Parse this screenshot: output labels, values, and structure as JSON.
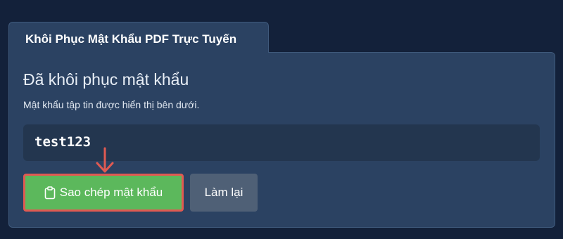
{
  "tab": {
    "label": "Khôi Phục Mật Khẩu PDF Trực Tuyến"
  },
  "result": {
    "title": "Đã khôi phục mật khẩu",
    "subtitle": "Mật khẩu tập tin được hiển thị bên dưới.",
    "password": "test123"
  },
  "buttons": {
    "copy_label": "Sao chép mật khẩu",
    "copy_icon": "clipboard-icon",
    "reset_label": "Làm lại"
  },
  "annotation": {
    "arrow_icon": "arrow-down-icon",
    "highlight_color": "#e05a52"
  },
  "colors": {
    "background": "#13213a",
    "panel": "#2b4262",
    "copy_button": "#5cb85c",
    "reset_button": "#4f6076"
  }
}
